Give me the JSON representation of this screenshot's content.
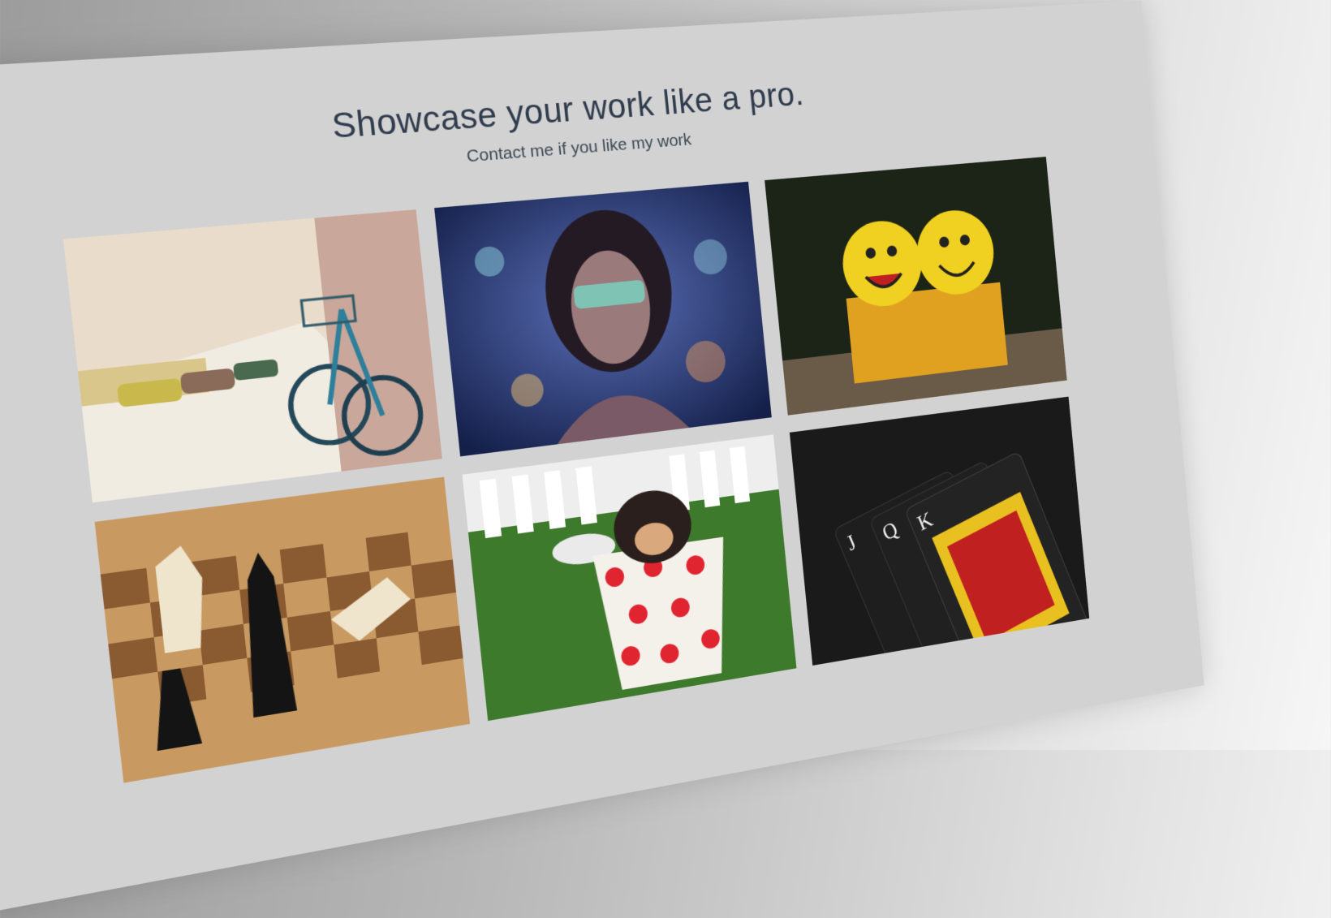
{
  "header": {
    "title": "Showcase your work like a pro.",
    "subtitle": "Contact me if you like my work"
  },
  "gallery": {
    "items": [
      {
        "icon": "bicycle-street-photo"
      },
      {
        "icon": "woman-sunglasses-photo"
      },
      {
        "icon": "smiley-plush-box-photo"
      },
      {
        "icon": "chess-pieces-photo"
      },
      {
        "icon": "puppy-in-cup-photo"
      },
      {
        "icon": "playing-cards-photo"
      }
    ]
  },
  "colors": {
    "panel": "#d2d2d2",
    "title": "#2f3b4c"
  }
}
